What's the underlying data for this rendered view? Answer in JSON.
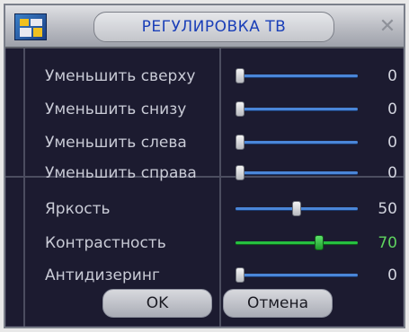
{
  "dialog": {
    "title": "РЕГУЛИРОВКА ТВ",
    "close_symbol": "✕"
  },
  "settings": [
    {
      "label": "Уменьшить сверху",
      "value": "0",
      "level": 0,
      "accent": false
    },
    {
      "label": "Уменьшить снизу",
      "value": "0",
      "level": 0,
      "accent": false
    },
    {
      "label": "Уменьшить слева",
      "value": "0",
      "level": 0,
      "accent": false
    },
    {
      "label": "Уменьшить справа",
      "value": "0",
      "level": 0,
      "accent": false
    },
    {
      "label": "Яркость",
      "value": "50",
      "level": 50,
      "accent": false
    },
    {
      "label": "Контрастность",
      "value": "70",
      "level": 70,
      "accent": true
    },
    {
      "label": "Антидизеринг",
      "value": "0",
      "level": 0,
      "accent": false
    }
  ],
  "buttons": {
    "ok_label": "OK",
    "cancel_label": "Отмена"
  },
  "colors": {
    "background": "#1c1b30",
    "slider_track": "#4a86d8",
    "accent_green": "#26c040",
    "title_text": "#1a3fb8"
  }
}
